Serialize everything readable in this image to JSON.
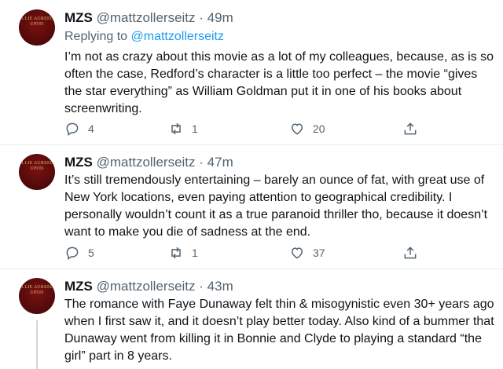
{
  "tweets": [
    {
      "name": "MZS",
      "handle": "@mattzollerseitz",
      "dot": "·",
      "time": "49m",
      "reply_prefix": "Replying to",
      "reply_mention": "@mattzollerseitz",
      "text": "I’m not as crazy about this movie as a lot of my colleagues, because, as is so often the case, Redford’s character is a little too perfect – the movie “gives the star everything” as William Goldman put it in one of his books about screenwriting.",
      "replies": "4",
      "retweets": "1",
      "likes": "20"
    },
    {
      "name": "MZS",
      "handle": "@mattzollerseitz",
      "dot": "·",
      "time": "47m",
      "text": "It’s still tremendously entertaining – barely an ounce of fat, with great use of New York locations, even paying attention to geographical credibility. I personally wouldn’t count it as a true paranoid thriller tho, because it doesn’t want to make you die of sadness at the end.",
      "replies": "5",
      "retweets": "1",
      "likes": "37"
    },
    {
      "name": "MZS",
      "handle": "@mattzollerseitz",
      "dot": "·",
      "time": "43m",
      "text": "The romance with Faye Dunaway felt thin & misogynistic even 30+ years ago when I first saw it, and it doesn’t play better today. Also kind of a bummer that Dunaway went from killing it in Bonnie and Clyde to playing a standard “the girl” part in 8 years."
    }
  ],
  "avatar_text": "A LIE AGREED UPON",
  "icons": {
    "reply": "reply-icon",
    "retweet": "retweet-icon",
    "like": "like-icon",
    "share": "share-icon"
  },
  "colors": {
    "text": "#0f1419",
    "secondary": "#536471",
    "link": "#1d9bf0",
    "avatar": "#6b0f0f"
  }
}
